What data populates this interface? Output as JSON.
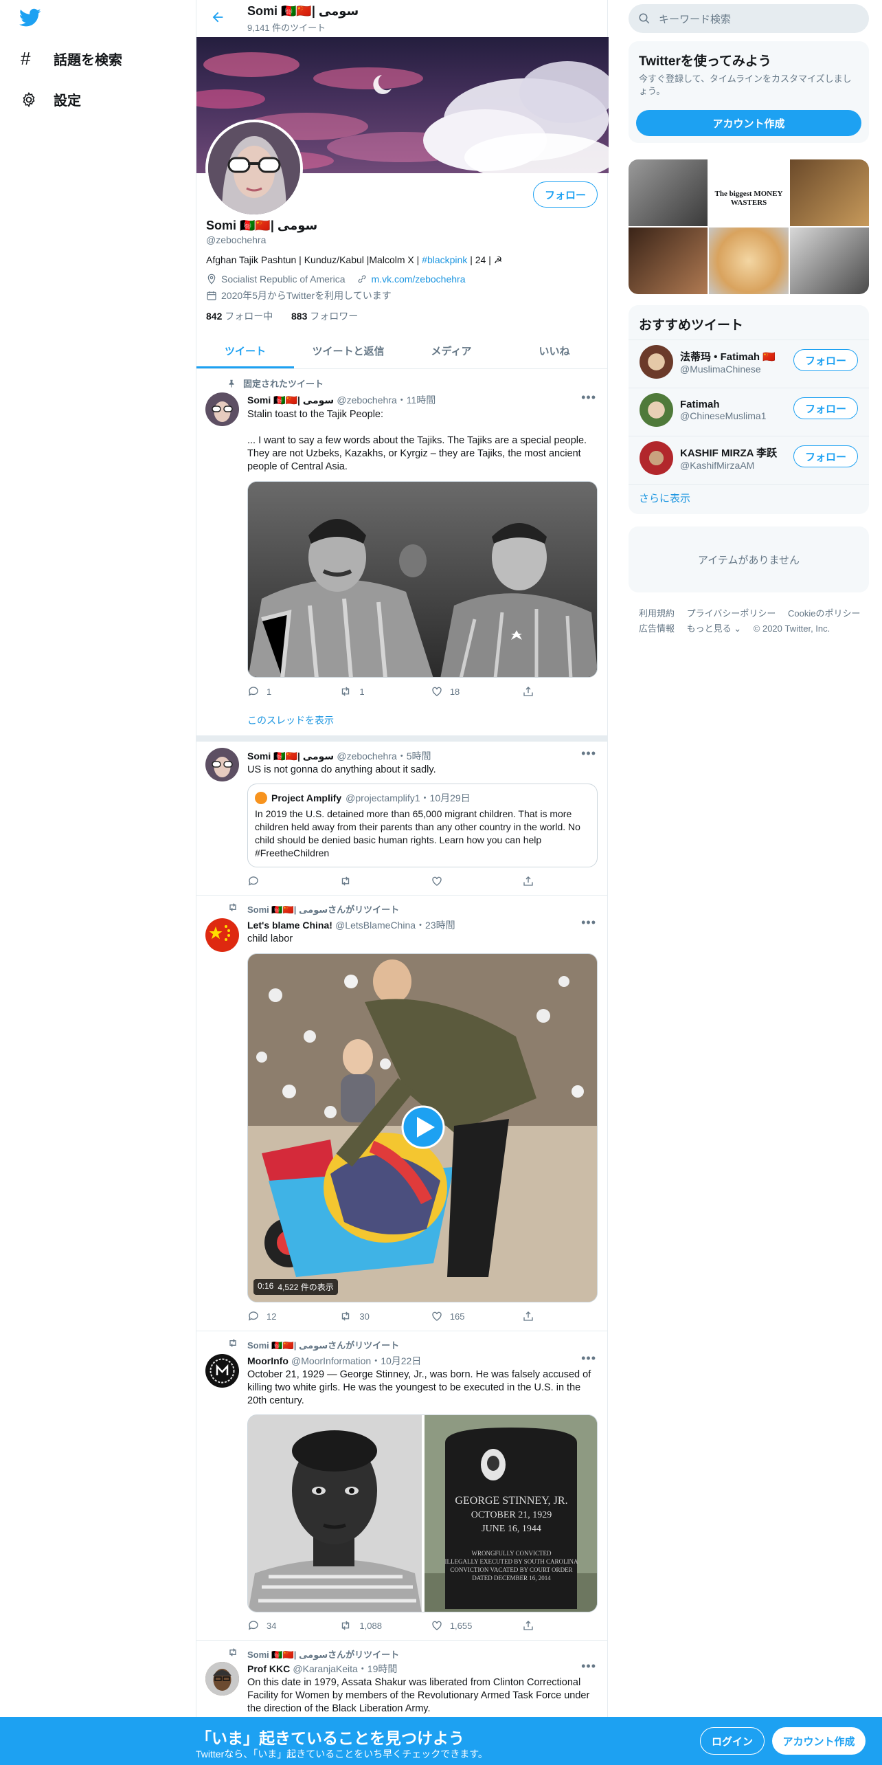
{
  "nav": {
    "explore_label": "話題を検索",
    "settings_label": "設定"
  },
  "profile": {
    "header_name": "Somi 🇦🇫🇨🇳| سومی",
    "header_tweet_count": "9,141 件のツイート",
    "name": "Somi 🇦🇫🇨🇳| سومی",
    "handle": "@zebochehra",
    "follow_label": "フォロー",
    "bio_prefix": "Afghan Tajik Pashtun | Kunduz/Kabul |Malcolm X |",
    "bio_hashtag": "#blackpink",
    "bio_suffix": "| 24 | ☭",
    "location": "Socialist Republic of America",
    "link": "m.vk.com/zebochehra",
    "joined": "2020年5月からTwitterを利用しています",
    "following_count": "842",
    "following_label": "フォロー中",
    "followers_count": "883",
    "followers_label": "フォロワー"
  },
  "tabs": [
    "ツイート",
    "ツイートと返信",
    "メディア",
    "いいね"
  ],
  "tweets": [
    {
      "pinned_label": "固定されたツイート",
      "name": "Somi 🇦🇫🇨🇳| سومی",
      "meta": "@zebochehra・11時間",
      "text1": "Stalin toast to the Tajik People:",
      "text2": "... I want to say a few words about the Tajiks. The Tajiks are a special people. They are not Uzbeks, Kazakhs, or Kyrgiz – they are Tajiks, the most ancient people of Central Asia.",
      "reply": "1",
      "retweet": "1",
      "like": "18",
      "thread_link": "このスレッドを表示"
    },
    {
      "name": "Somi 🇦🇫🇨🇳| سومی",
      "meta": "@zebochehra・5時間",
      "text1": "US is not gonna do anything about it sadly.",
      "quote_name": "Project Amplify",
      "quote_meta": "@projectamplify1・10月29日",
      "quote_text": "In 2019 the U.S. detained more than 65,000 migrant children. That is more children held away from their parents than any other country in the world. No child should be denied basic human rights. Learn how you can help #FreetheChildren",
      "reply": "",
      "retweet": "",
      "like": ""
    },
    {
      "retweet_label": "Somi 🇦🇫🇨🇳| سومیさんがリツイート",
      "name": "Let's blame China!",
      "meta": "@LetsBlameChina・23時間",
      "text1": "child labor",
      "video_time": "0:16",
      "video_views": "4,522 件の表示",
      "reply": "12",
      "retweet": "30",
      "like": "165"
    },
    {
      "retweet_label": "Somi 🇦🇫🇨🇳| سومیさんがリツイート",
      "name": "MoorInfo",
      "meta": "@MoorInformation・10月22日",
      "text1": "October 21, 1929 — George Stinney, Jr., was born.  He was falsely accused of killing two white girls.  He was the youngest to be executed in the U.S. in the 20th century.",
      "tomb_lines": [
        "GEORGE STINNEY, JR.",
        "OCTOBER 21, 1929",
        "JUNE 16, 1944",
        "WRONGFULLY CONVICTED",
        "ILLEGALLY EXECUTED BY SOUTH CAROLINA",
        "CONVICTION VACATED BY COURT ORDER",
        "DATED DECEMBER 16, 2014"
      ],
      "reply": "34",
      "retweet": "1,088",
      "like": "1,655"
    },
    {
      "retweet_label": "Somi 🇦🇫🇨🇳| سومیさんがリツイート",
      "name": "Prof KKC",
      "meta": "@KaranjaKeita・19時間",
      "text1": "On this date in 1979, Assata Shakur was liberated from Clinton Correctional Facility for Women by members of the Revolutionary Armed Task Force under the direction of the Black Liberation Army."
    }
  ],
  "right": {
    "search_placeholder": "キーワード検索",
    "signup_title": "Twitterを使ってみよう",
    "signup_desc": "今すぐ登録して、タイムラインをカスタマイズしましょう。",
    "signup_button": "アカウント作成",
    "photo_grid_caption": "The biggest MONEY WASTERS",
    "who_title": "おすすめツイート",
    "who": [
      {
        "name": "法蒂玛 • Fatimah 🇨🇳",
        "handle": "@MuslimaChinese",
        "button": "フォロー"
      },
      {
        "name": "Fatimah",
        "handle": "@ChineseMuslima1",
        "button": "フォロー"
      },
      {
        "name": "KASHIF MIRZA 李跃",
        "handle": "@KashifMirzaAM",
        "button": "フォロー"
      }
    ],
    "show_more": "さらに表示",
    "empty_text": "アイテムがありません",
    "footer_links": [
      "利用規約",
      "プライバシーポリシー",
      "Cookieのポリシー",
      "広告情報",
      "もっと見る ⌄",
      "© 2020 Twitter, Inc."
    ]
  },
  "bottom": {
    "title": "「いま」起きていることを見つけよう",
    "subtitle": "Twitterなら、「いま」起きていることをいち早くチェックできます。",
    "login": "ログイン",
    "signup": "アカウント作成"
  },
  "colors": {
    "accent": "#1da1f2",
    "border": "#e6ecf0",
    "muted": "#657786"
  }
}
